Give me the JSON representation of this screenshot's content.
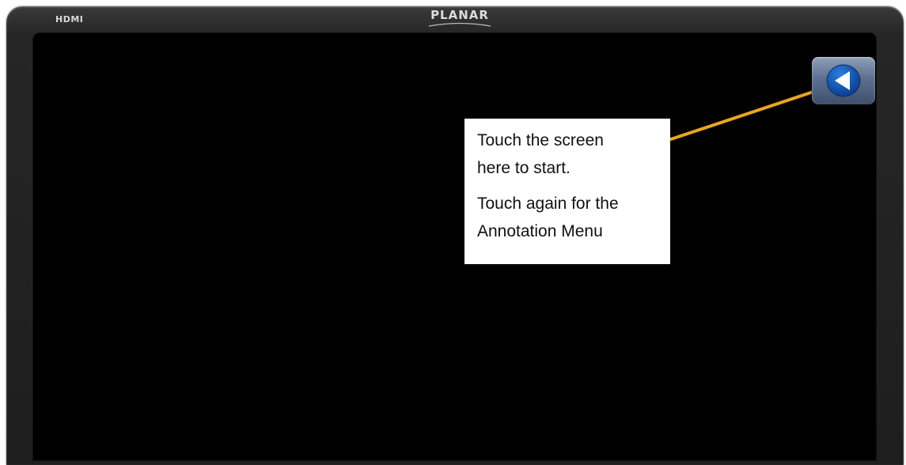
{
  "monitor": {
    "input_label": "HDMI",
    "brand": "PLANAR",
    "bezel_color": "#222222",
    "screen_color": "#000000"
  },
  "touch_button": {
    "icon": "left-arrow-circle-icon",
    "color": "#0a56b5"
  },
  "callout": {
    "line1": "Touch the screen",
    "line2": "here to start.",
    "line3": "Touch again for the",
    "line4": "Annotation Menu",
    "pointer_color": "#e7a521"
  }
}
